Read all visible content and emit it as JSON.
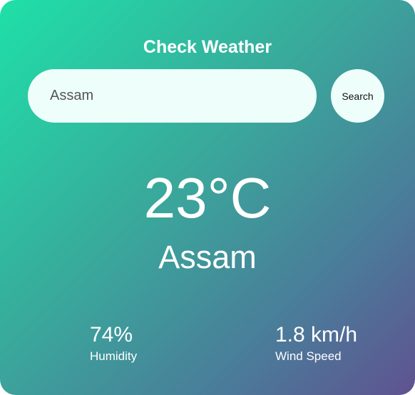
{
  "title": "Check Weather",
  "search": {
    "value": "Assam",
    "button_label": "Search"
  },
  "weather": {
    "temperature": "23°C",
    "city": "Assam"
  },
  "stats": {
    "humidity": {
      "value": "74%",
      "label": "Humidity"
    },
    "wind": {
      "value": "1.8 km/h",
      "label": "Wind Speed"
    }
  }
}
